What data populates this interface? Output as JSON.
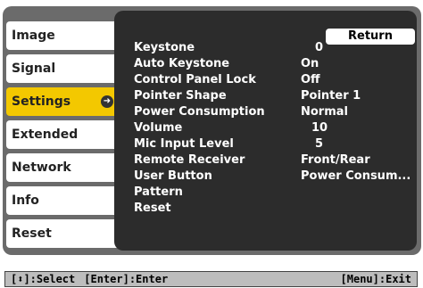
{
  "tabs": [
    {
      "label": "Image"
    },
    {
      "label": "Signal"
    },
    {
      "label": "Settings"
    },
    {
      "label": "Extended"
    },
    {
      "label": "Network"
    },
    {
      "label": "Info"
    },
    {
      "label": "Reset"
    }
  ],
  "active_tab": "Settings",
  "return_label": "Return",
  "settings": [
    {
      "label": "Keystone",
      "value": "0"
    },
    {
      "label": "Auto Keystone",
      "value": "On"
    },
    {
      "label": "Control Panel Lock",
      "value": "Off"
    },
    {
      "label": "Pointer Shape",
      "value": "Pointer 1"
    },
    {
      "label": "Power Consumption",
      "value": "Normal"
    },
    {
      "label": "Volume",
      "value": "10"
    },
    {
      "label": "Mic Input Level",
      "value": "5"
    },
    {
      "label": "Remote Receiver",
      "value": "Front/Rear"
    },
    {
      "label": "User Button",
      "value": "Power Consum..."
    },
    {
      "label": "Pattern",
      "value": ""
    },
    {
      "label": "Reset",
      "value": ""
    }
  ],
  "status_bar": {
    "select": "[⬍]:Select",
    "enter": "[Enter]:Enter",
    "exit": "[Menu]:Exit"
  }
}
